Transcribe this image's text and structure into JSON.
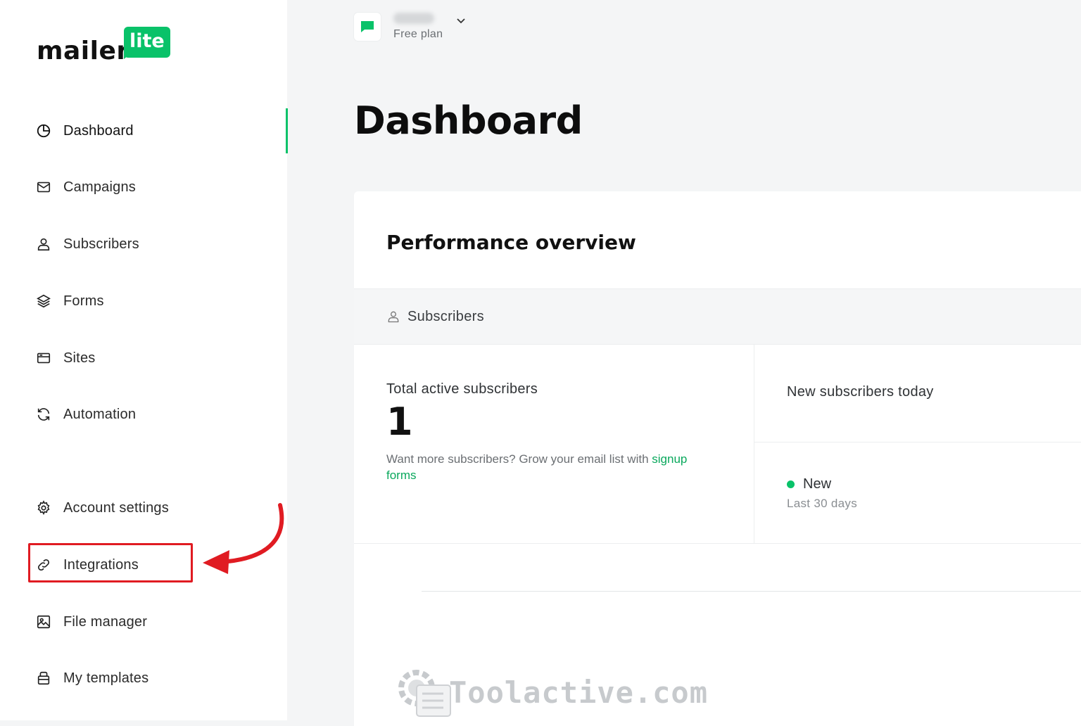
{
  "brand": {
    "word": "mailer",
    "badge": "lite",
    "accent": "#09c269",
    "highlight": "#e01b22"
  },
  "sidebar": {
    "items": [
      {
        "label": "Dashboard",
        "icon": "dashboard-icon",
        "active": true
      },
      {
        "label": "Campaigns",
        "icon": "mail-icon"
      },
      {
        "label": "Subscribers",
        "icon": "user-icon"
      },
      {
        "label": "Forms",
        "icon": "layers-icon"
      },
      {
        "label": "Sites",
        "icon": "browser-icon"
      },
      {
        "label": "Automation",
        "icon": "refresh-icon"
      },
      {
        "label": "Account settings",
        "icon": "gear-icon"
      },
      {
        "label": "Integrations",
        "icon": "link-icon",
        "highlighted": true
      },
      {
        "label": "File manager",
        "icon": "image-icon"
      },
      {
        "label": "My templates",
        "icon": "template-icon"
      }
    ]
  },
  "account": {
    "plan": "Free plan",
    "icon": "chat-icon"
  },
  "page": {
    "title": "Dashboard"
  },
  "card": {
    "title": "Performance overview",
    "tab_label": "Subscribers",
    "total_label": "Total active subscribers",
    "total_value": "1",
    "hint_prefix": "Want more subscribers? Grow your email list with ",
    "hint_link": "signup forms",
    "new_today_label": "New subscribers today",
    "legend_name": "New",
    "legend_period": "Last 30 days"
  },
  "watermark": {
    "text": "Toolactive.com"
  }
}
